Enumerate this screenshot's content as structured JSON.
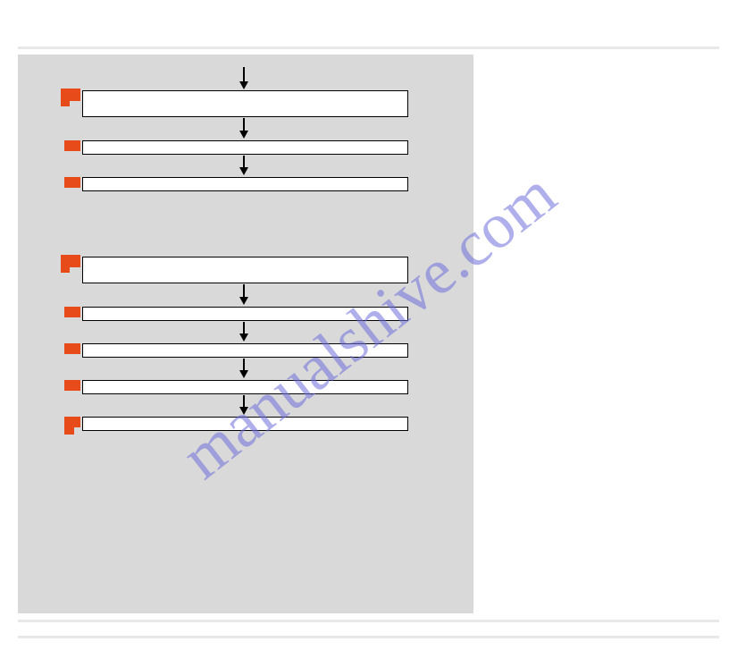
{
  "watermark": "manualshive.com",
  "diagram": {
    "group1": {
      "steps": [
        {
          "type": "large"
        },
        {
          "type": "small"
        },
        {
          "type": "small"
        }
      ]
    },
    "group2": {
      "steps": [
        {
          "type": "large"
        },
        {
          "type": "small"
        },
        {
          "type": "small"
        },
        {
          "type": "small"
        },
        {
          "type": "small"
        }
      ]
    }
  }
}
